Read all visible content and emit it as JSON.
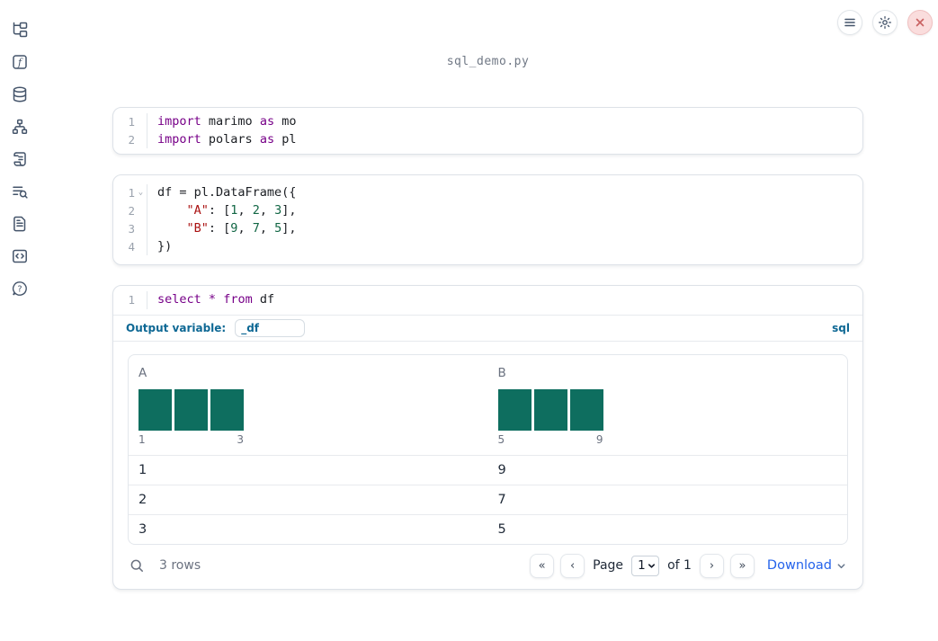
{
  "window": {
    "title": "sql_demo.py"
  },
  "colors": {
    "keyword": "#770088",
    "string": "#aa1111",
    "number": "#116644",
    "accent_blue": "#0e6894",
    "link_blue": "#2563eb",
    "histogram_teal": "#0e6e5f"
  },
  "topbar": {
    "buttons": [
      {
        "icon": "hamburger-menu-icon"
      },
      {
        "icon": "gear-icon"
      },
      {
        "icon": "close-x-icon"
      }
    ]
  },
  "sidebar": {
    "items": [
      {
        "icon": "file-tree-icon"
      },
      {
        "icon": "function-icon"
      },
      {
        "icon": "database-icon"
      },
      {
        "icon": "dependency-graph-icon"
      },
      {
        "icon": "scroll-logs-icon"
      },
      {
        "icon": "list-search-icon"
      },
      {
        "icon": "document-icon"
      },
      {
        "icon": "code-snippet-icon"
      },
      {
        "icon": "help-bubble-icon"
      }
    ]
  },
  "cells": [
    {
      "name": "imports-cell",
      "lines": [
        {
          "num": "1",
          "fold": "",
          "tokens": [
            {
              "t": "import",
              "c": "keyword"
            },
            {
              "t": " marimo ",
              "c": "plain"
            },
            {
              "t": "as",
              "c": "keyword"
            },
            {
              "t": " mo",
              "c": "plain"
            }
          ]
        },
        {
          "num": "2",
          "fold": "",
          "tokens": [
            {
              "t": "import",
              "c": "keyword"
            },
            {
              "t": " polars ",
              "c": "plain"
            },
            {
              "t": "as",
              "c": "keyword"
            },
            {
              "t": " pl",
              "c": "plain"
            }
          ]
        }
      ]
    },
    {
      "name": "dataframe-cell",
      "lines": [
        {
          "num": "1",
          "fold": "⌄",
          "tokens": [
            {
              "t": "df = pl.DataFrame({",
              "c": "plain"
            }
          ]
        },
        {
          "num": "2",
          "fold": "",
          "tokens": [
            {
              "t": "    ",
              "c": "plain"
            },
            {
              "t": "\"A\"",
              "c": "string"
            },
            {
              "t": ": [",
              "c": "plain"
            },
            {
              "t": "1",
              "c": "number"
            },
            {
              "t": ", ",
              "c": "plain"
            },
            {
              "t": "2",
              "c": "number"
            },
            {
              "t": ", ",
              "c": "plain"
            },
            {
              "t": "3",
              "c": "number"
            },
            {
              "t": "],",
              "c": "plain"
            }
          ]
        },
        {
          "num": "3",
          "fold": "",
          "tokens": [
            {
              "t": "    ",
              "c": "plain"
            },
            {
              "t": "\"B\"",
              "c": "string"
            },
            {
              "t": ": [",
              "c": "plain"
            },
            {
              "t": "9",
              "c": "number"
            },
            {
              "t": ", ",
              "c": "plain"
            },
            {
              "t": "7",
              "c": "number"
            },
            {
              "t": ", ",
              "c": "plain"
            },
            {
              "t": "5",
              "c": "number"
            },
            {
              "t": "],",
              "c": "plain"
            }
          ]
        },
        {
          "num": "4",
          "fold": "",
          "tokens": [
            {
              "t": "})",
              "c": "plain"
            }
          ]
        }
      ]
    },
    {
      "name": "sql-cell",
      "lines": [
        {
          "num": "1",
          "fold": "",
          "tokens": [
            {
              "t": "select",
              "c": "keyword"
            },
            {
              "t": " ",
              "c": "plain"
            },
            {
              "t": "*",
              "c": "keyword"
            },
            {
              "t": " ",
              "c": "plain"
            },
            {
              "t": "from",
              "c": "keyword"
            },
            {
              "t": " df",
              "c": "plain"
            }
          ]
        }
      ]
    }
  ],
  "sql_cell": {
    "output_variable_label": "Output variable:",
    "output_variable_value": "_df",
    "language_badge": "sql"
  },
  "table": {
    "columns": [
      {
        "name": "A",
        "histogram": {
          "bars": [
            1,
            1,
            1
          ],
          "min_label": "1",
          "max_label": "3"
        }
      },
      {
        "name": "B",
        "histogram": {
          "bars": [
            1,
            1,
            1
          ],
          "min_label": "5",
          "max_label": "9"
        }
      }
    ],
    "rows": [
      [
        "1",
        "9"
      ],
      [
        "2",
        "7"
      ],
      [
        "3",
        "5"
      ]
    ],
    "footer": {
      "row_count": "3 rows",
      "first_page": "«",
      "prev_page": "‹",
      "next_page": "›",
      "last_page": "»",
      "page_label": "Page",
      "page_value": "1",
      "page_total": "of 1",
      "download_label": "Download"
    }
  }
}
